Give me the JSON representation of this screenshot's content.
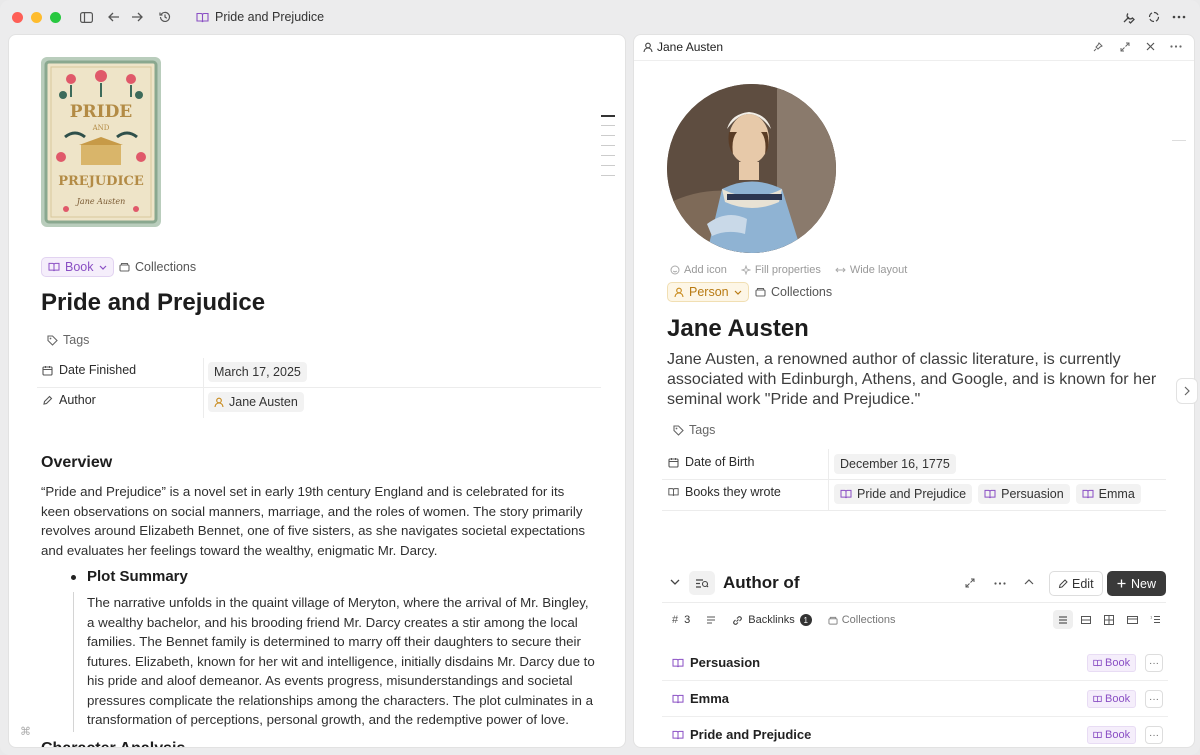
{
  "window": {
    "title": "Pride and Prejudice"
  },
  "book": {
    "type_label": "Book",
    "collections_label": "Collections",
    "title": "Pride and Prejudice",
    "tags_label": "Tags",
    "props": [
      {
        "name": "Date Finished",
        "value": "March 17, 2025"
      },
      {
        "name": "Author",
        "value": "Jane Austen"
      }
    ],
    "overview_heading": "Overview",
    "overview_text": "“Pride and Prejudice” is a novel set in early 19th century England and is celebrated for its keen observations on social manners, marriage, and the roles of women. The story primarily revolves around Elizabeth Bennet, one of five sisters, as she navigates societal expectations and evaluates her feelings toward the wealthy, enigmatic Mr. Darcy.",
    "plot_heading": "Plot Summary",
    "plot_text": "The narrative unfolds in the quaint village of Meryton, where the arrival of Mr. Bingley, a wealthy bachelor, and his brooding friend Mr. Darcy creates a stir among the local families. The Bennet family is determined to marry off their daughters to secure their futures. Elizabeth, known for her wit and intelligence, initially disdains Mr. Darcy due to his pride and aloof demeanor. As events progress, misunderstandings and societal pressures complicate the relationships among the characters. The plot culminates in a transformation of perceptions, personal growth, and the redemptive power of love.",
    "next_heading": "Character Analysis",
    "cover_text": {
      "line1": "PRIDE",
      "line2": "AND",
      "line3": "PREJUDICE",
      "author": "Jane Austen"
    }
  },
  "person": {
    "header_name": "Jane Austen",
    "add_icon": "Add icon",
    "fill_properties": "Fill properties",
    "wide_layout": "Wide layout",
    "type_label": "Person",
    "collections_label": "Collections",
    "title": "Jane Austen",
    "description": "Jane Austen, a renowned author of classic literature, is currently associated with Edinburgh, Athens, and Google, and is known for her seminal work \"Pride and Prejudice.\"",
    "tags_label": "Tags",
    "dob_label": "Date of Birth",
    "dob_value": "December 16, 1775",
    "books_label": "Books they wrote",
    "books": [
      "Pride and Prejudice",
      "Persuasion",
      "Emma"
    ]
  },
  "author_of": {
    "title": "Author of",
    "edit_label": "Edit",
    "new_label": "New",
    "count": "3",
    "backlinks_label": "Backlinks",
    "backlinks_count": "1",
    "collections_label": "Collections",
    "rows": [
      {
        "title": "Persuasion",
        "tag": "Book"
      },
      {
        "title": "Emma",
        "tag": "Book"
      },
      {
        "title": "Pride and Prejudice",
        "tag": "Book"
      }
    ]
  },
  "colors": {
    "book_accent": "#8a4fc4",
    "person_accent": "#c8891a",
    "new_button": "#3a3a3a"
  }
}
